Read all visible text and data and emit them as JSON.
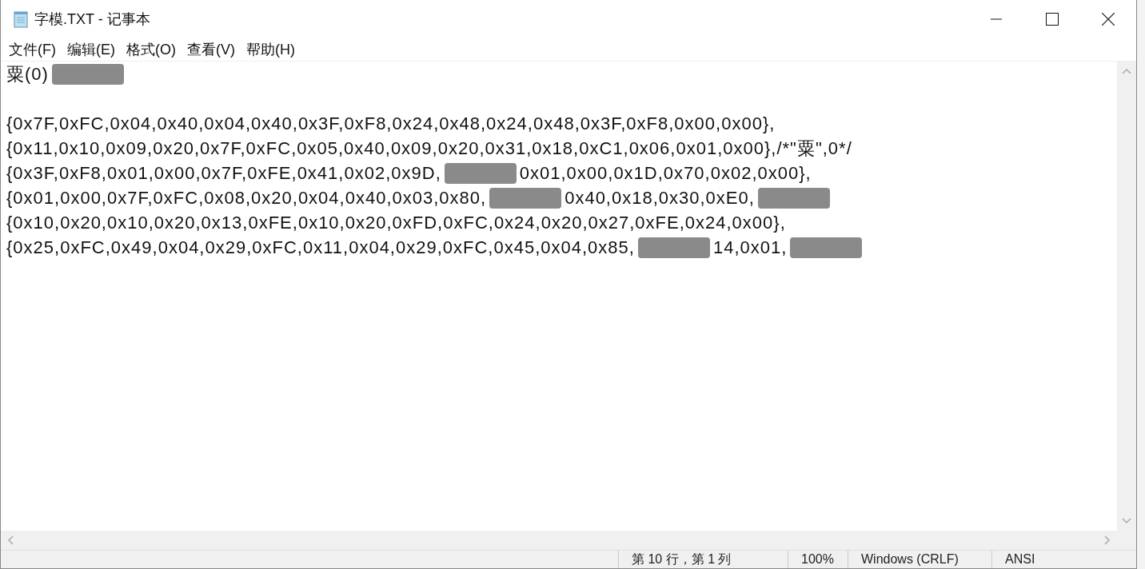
{
  "window": {
    "title": "字模.TXT - 记事本"
  },
  "menu": [
    "文件(F)",
    "编辑(E)",
    "格式(O)",
    "查看(V)",
    "帮助(H)"
  ],
  "editor": {
    "lines": [
      {
        "kind": "text",
        "segments": [
          {
            "kind": "text",
            "text": "粟(0)"
          },
          {
            "kind": "redaction"
          }
        ]
      },
      {
        "kind": "blank"
      },
      {
        "kind": "text",
        "segments": [
          {
            "kind": "text",
            "text": "{0x7F,0xFC,0x04,0x40,0x04,0x40,0x3F,0xF8,0x24,0x48,0x24,0x48,0x3F,0xF8,0x00,0x00},"
          }
        ]
      },
      {
        "kind": "text",
        "segments": [
          {
            "kind": "text",
            "text": "{0x11,0x10,0x09,0x20,0x7F,0xFC,0x05,0x40,0x09,0x20,0x31,0x18,0xC1,0x06,0x01,0x00},/*\"粟\",0*/"
          }
        ]
      },
      {
        "kind": "text",
        "segments": [
          {
            "kind": "text",
            "text": "{0x3F,0xF8,0x01,0x00,0x7F,0xFE,0x41,0x02,0x9D,"
          },
          {
            "kind": "redaction"
          },
          {
            "kind": "text",
            "text": "0x01,0x00,0x1D,0x70,0x02,0x00},"
          }
        ]
      },
      {
        "kind": "text",
        "segments": [
          {
            "kind": "text",
            "text": "{0x01,0x00,0x7F,0xFC,0x08,0x20,0x04,0x40,0x03,0x80,"
          },
          {
            "kind": "redaction"
          },
          {
            "kind": "text",
            "text": "0x40,0x18,0x30,0xE0,"
          },
          {
            "kind": "redaction"
          }
        ]
      },
      {
        "kind": "text",
        "segments": [
          {
            "kind": "text",
            "text": "{0x10,0x20,0x10,0x20,0x13,0xFE,0x10,0x20,0xFD,0xFC,0x24,0x20,0x27,0xFE,0x24,0x00},"
          }
        ]
      },
      {
        "kind": "text",
        "segments": [
          {
            "kind": "text",
            "text": "{0x25,0xFC,0x49,0x04,0x29,0xFC,0x11,0x04,0x29,0xFC,0x45,0x04,0x85,"
          },
          {
            "kind": "redaction"
          },
          {
            "kind": "text",
            "text": "14,0x01,"
          },
          {
            "kind": "redaction"
          }
        ]
      }
    ]
  },
  "status_bar": [
    "第 10 行，第 1 列",
    "100%",
    "Windows (CRLF)",
    "ANSI"
  ]
}
